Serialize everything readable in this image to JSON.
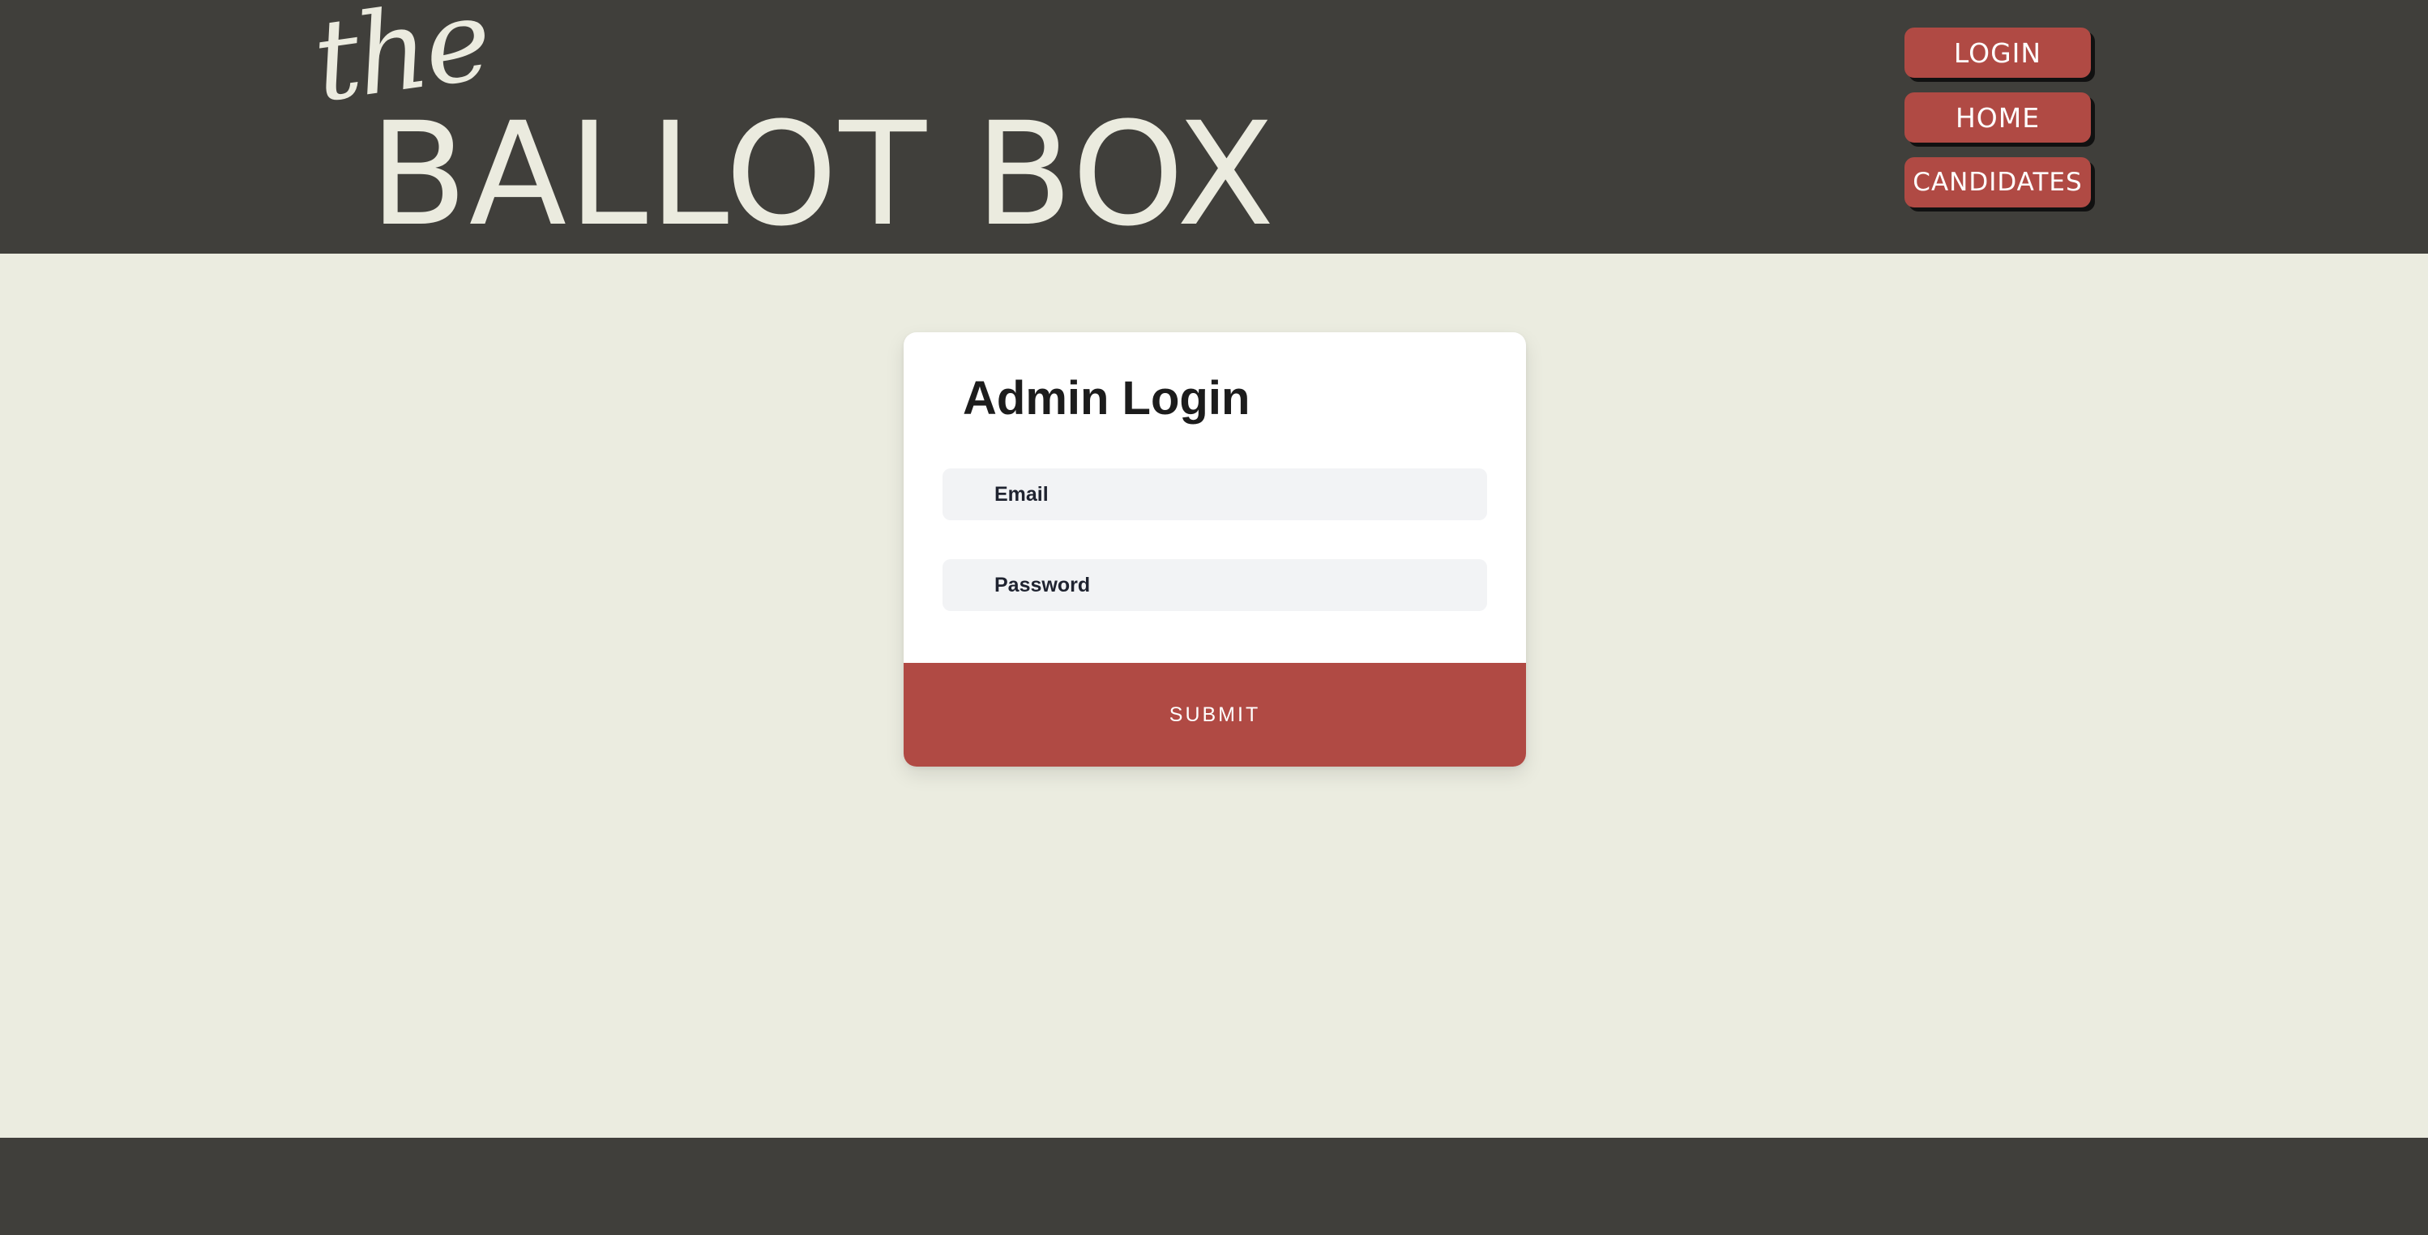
{
  "header": {
    "logo_small": "the",
    "logo_main": "BALLOT BOX",
    "nav": {
      "login_label": "LOGIN",
      "home_label": "HOME",
      "candidates_label": "CANDIDATES"
    }
  },
  "login_card": {
    "title": "Admin Login",
    "email_label": "Email",
    "password_label": "Password",
    "submit_label": "SUBMIT"
  },
  "colors": {
    "header_bg": "#403f3b",
    "page_bg": "#ebece0",
    "accent": "#b04a44",
    "logo_text": "#ebebdf"
  }
}
